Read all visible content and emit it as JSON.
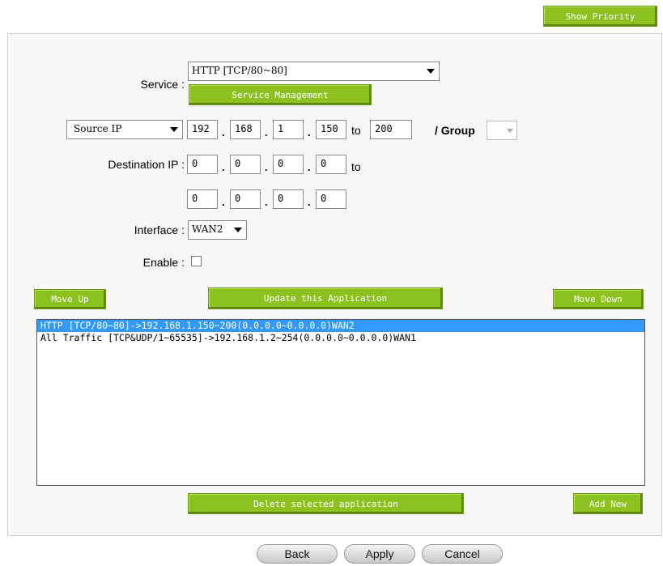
{
  "header": {
    "show_priority_label": "Show Priority"
  },
  "form": {
    "service_label": "Service :",
    "service_value": "HTTP [TCP/80~80]",
    "service_management_label": "Service Management",
    "source_type": "Source IP",
    "source_ip": [
      "192",
      "168",
      "1",
      "150"
    ],
    "source_to_label": "to",
    "source_to_value": "200",
    "group_label": "/ Group",
    "destination_label": "Destination IP :",
    "destination_ip_from": [
      "0",
      "0",
      "0",
      "0"
    ],
    "destination_to_label": "to",
    "destination_ip_to": [
      "0",
      "0",
      "0",
      "0"
    ],
    "interface_label": "Interface :",
    "interface_value": "WAN2",
    "enable_label": "Enable :",
    "enable_checked": false
  },
  "actions": {
    "move_up_label": "Move Up",
    "update_label": "Update this Application",
    "move_down_label": "Move Down",
    "delete_label": "Delete selected application",
    "add_new_label": "Add New"
  },
  "app_list": [
    {
      "text": "HTTP [TCP/80~80]->192.168.1.150~200(0.0.0.0~0.0.0.0)WAN2",
      "selected": true
    },
    {
      "text": "All Traffic [TCP&UDP/1~65535]->192.168.1.2~254(0.0.0.0~0.0.0.0)WAN1",
      "selected": false
    }
  ],
  "footer": {
    "back_label": "Back",
    "apply_label": "Apply",
    "cancel_label": "Cancel"
  },
  "colors": {
    "accent_green": "#8cc21f",
    "selection_blue": "#3399ff"
  }
}
